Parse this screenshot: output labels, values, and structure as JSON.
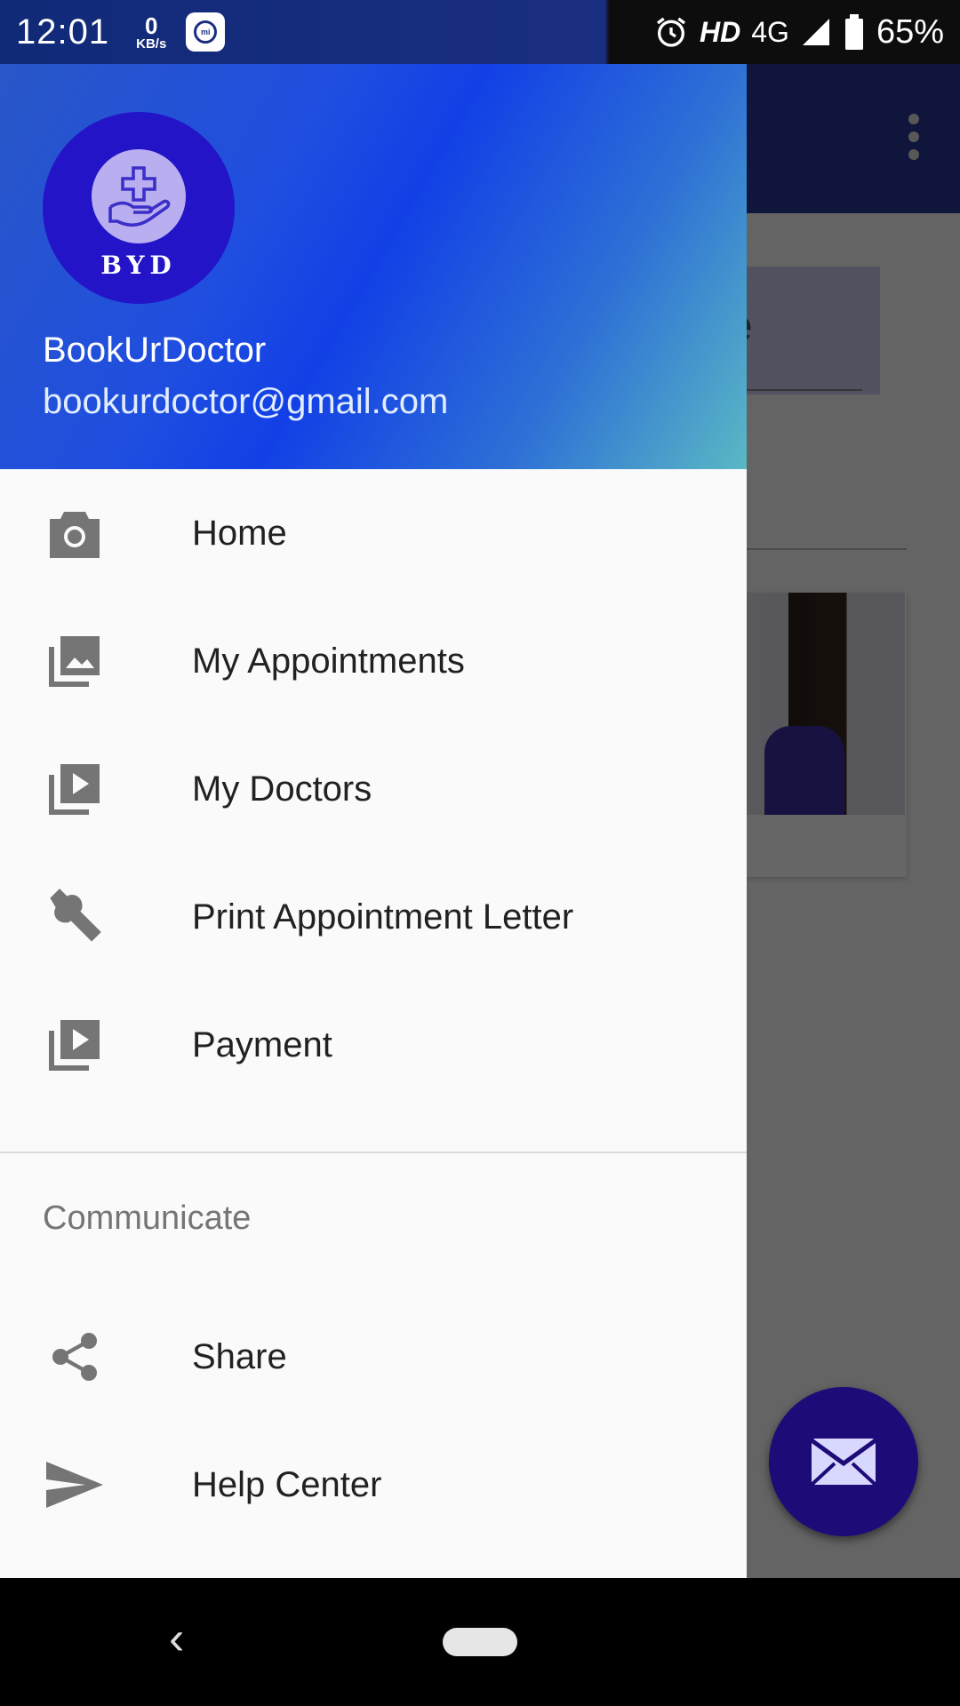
{
  "status_bar": {
    "time": "12:01",
    "net_speed_value": "0",
    "net_speed_unit": "KB/s",
    "hd": "HD",
    "network": "4G",
    "battery": "65%",
    "icons": [
      "mi-icon",
      "alarm-icon",
      "signal-icon",
      "battery-icon"
    ]
  },
  "drawer": {
    "header": {
      "avatar_text": "BYD",
      "name": "BookUrDoctor",
      "email": "bookurdoctor@gmail.com",
      "gradient_colors": [
        "#2a57c8",
        "#1240e6",
        "#5ab8c4"
      ]
    },
    "items": [
      {
        "label": "Home",
        "icon": "camera-icon"
      },
      {
        "label": "My Appointments",
        "icon": "gallery-icon"
      },
      {
        "label": "My Doctors",
        "icon": "slideshow-icon"
      },
      {
        "label": "Print Appointment Letter",
        "icon": "wrench-icon"
      },
      {
        "label": "Payment",
        "icon": "slideshow-icon"
      }
    ],
    "section_title": "Communicate",
    "section_items": [
      {
        "label": "Share",
        "icon": "share-icon"
      },
      {
        "label": "Help Center",
        "icon": "send-icon"
      }
    ]
  },
  "background_app": {
    "field_text_fragment": "e",
    "toolbar_color": "#283593"
  },
  "fab": {
    "icon": "mail-icon",
    "color": "#1d0b78"
  }
}
